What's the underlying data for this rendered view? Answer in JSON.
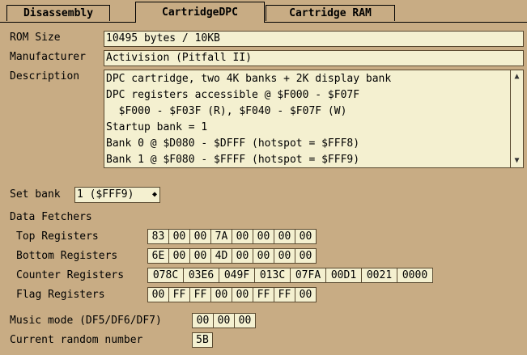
{
  "tabs": [
    {
      "label": "Disassembly"
    },
    {
      "label": "CartridgeDPC"
    },
    {
      "label": "Cartridge RAM"
    }
  ],
  "info": {
    "rom_size_label": "ROM Size",
    "rom_size_value": "10495 bytes / 10KB",
    "manufacturer_label": "Manufacturer",
    "manufacturer_value": "Activision (Pitfall II)",
    "description_label": "Description",
    "description_lines": [
      "DPC cartridge, two 4K banks + 2K display bank",
      "DPC registers accessible @ $F000 - $F07F",
      "  $F000 - $F03F (R), $F040 - $F07F (W)",
      "Startup bank = 1",
      "Bank 0 @ $D080 - $DFFF (hotspot = $FFF8)",
      "Bank 1 @ $F080 - $FFFF (hotspot = $FFF9)"
    ]
  },
  "bank": {
    "label": "Set bank",
    "selected": "1 ($FFF9)"
  },
  "fetchers": {
    "title": "Data Fetchers",
    "top_label": "Top Registers",
    "top_values": [
      "83",
      "00",
      "00",
      "7A",
      "00",
      "00",
      "00",
      "00"
    ],
    "bottom_label": "Bottom Registers",
    "bottom_values": [
      "6E",
      "00",
      "00",
      "4D",
      "00",
      "00",
      "00",
      "00"
    ],
    "counter_label": "Counter Registers",
    "counter_values": [
      "078C",
      "03E6",
      "049F",
      "013C",
      "07FA",
      "00D1",
      "0021",
      "0000"
    ],
    "flag_label": "Flag Registers",
    "flag_values": [
      "00",
      "FF",
      "FF",
      "00",
      "00",
      "FF",
      "FF",
      "00"
    ]
  },
  "music": {
    "label": "Music mode (DF5/DF6/DF7)",
    "values": [
      "00",
      "00",
      "00"
    ]
  },
  "random": {
    "label": "Current random number",
    "value": "5B"
  },
  "icons": {
    "scroll_up": "scroll-up-arrow-icon",
    "scroll_down": "scroll-down-arrow-icon",
    "dropdown": "chevron-updown-icon"
  }
}
